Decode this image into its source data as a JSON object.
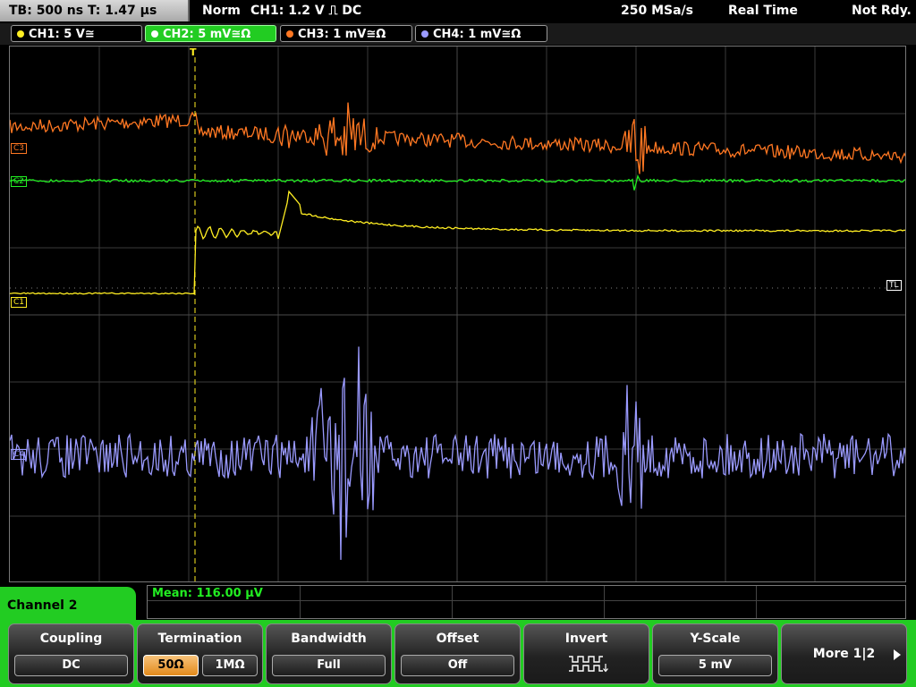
{
  "topbar": {
    "timebase": "TB: 500 ns  T: 1.47 µs",
    "mode": "Norm",
    "trigger": "CH1: 1.2 V ⎍ DC",
    "sample_rate": "250 MSa/s",
    "acq_mode": "Real Time",
    "status": "Not Rdy."
  },
  "channels": [
    {
      "label": "CH1: 5 V≅",
      "color": "#ffee22",
      "active": false
    },
    {
      "label": "CH2: 5 mV≅Ω",
      "color": "#22ee22",
      "active": true
    },
    {
      "label": "CH3: 1 mV≅Ω",
      "color": "#ff7722",
      "active": false
    },
    {
      "label": "CH4: 1 mV≅Ω",
      "color": "#9a9aff",
      "active": false
    }
  ],
  "screen": {
    "markers": {
      "c3": "C3",
      "c2": "C2",
      "c1": "C1",
      "c4": "C4",
      "tl": "TL",
      "trigger": "T"
    }
  },
  "measurement": {
    "text": "Mean: 116.00 µV"
  },
  "menu": {
    "title": "Channel 2",
    "coupling": {
      "label": "Coupling",
      "value": "DC"
    },
    "termination": {
      "label": "Termination",
      "option_a": "50Ω",
      "option_b": "1MΩ"
    },
    "bandwidth": {
      "label": "Bandwidth",
      "value": "Full"
    },
    "offset": {
      "label": "Offset",
      "value": "Off"
    },
    "invert": {
      "label": "Invert"
    },
    "yscale": {
      "label": "Y-Scale",
      "value": "5 mV"
    },
    "more": {
      "label": "More 1|2"
    }
  }
}
